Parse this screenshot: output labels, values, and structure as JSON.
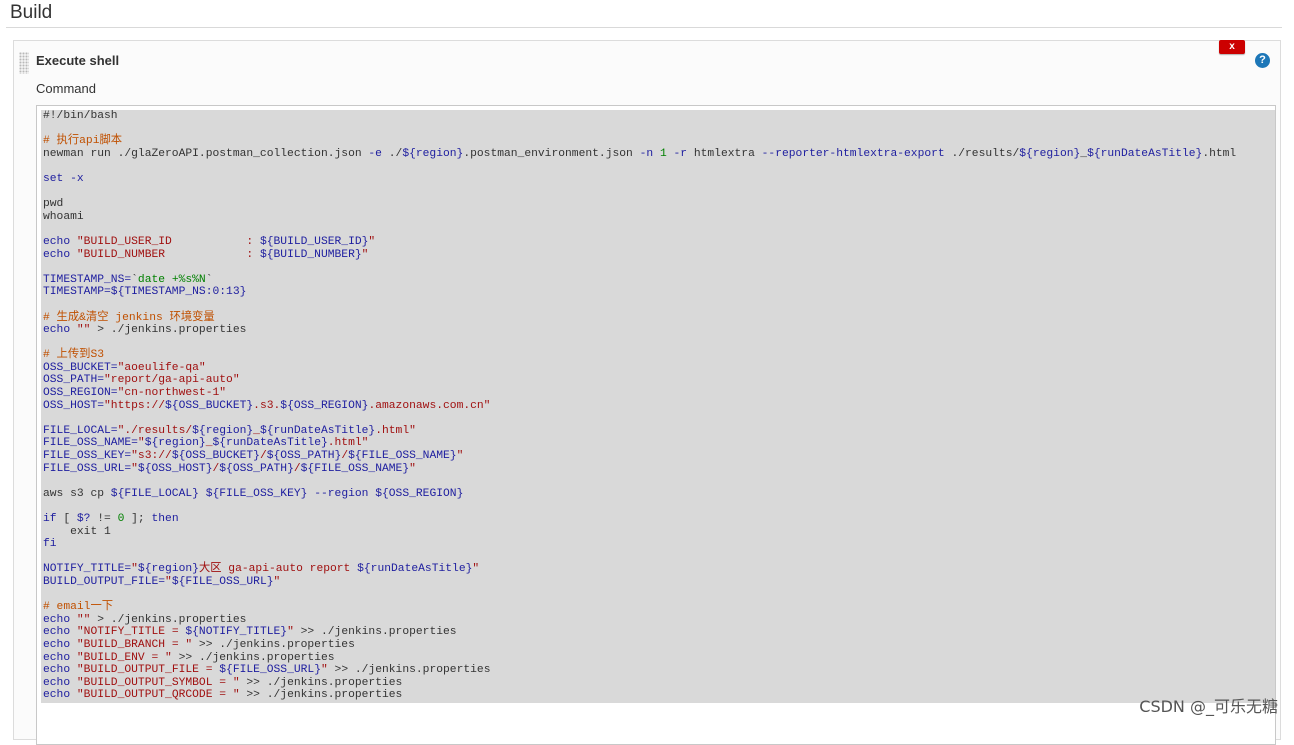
{
  "section": {
    "title": "Build"
  },
  "step": {
    "title": "Execute shell",
    "delete_label": "x",
    "help_label": "?",
    "command_label": "Command"
  },
  "colors": {
    "comment": "#c05000",
    "keyword": "#2020a0",
    "string": "#a01010",
    "variable": "#2020a0",
    "text": "#333333",
    "green": "#008000",
    "delete_button": "#cc0000",
    "help_icon": "#1d77b8",
    "code_highlight": "#d9d9d9"
  },
  "code_lines": [
    [
      {
        "t": "txt",
        "v": "#!/bin/bash"
      }
    ],
    [],
    [
      {
        "t": "cmt",
        "v": "# 执行api脚本"
      }
    ],
    [
      {
        "t": "txt",
        "v": "newman run ./glaZeroAPI.postman_collection.json "
      },
      {
        "t": "kw",
        "v": "-e"
      },
      {
        "t": "txt",
        "v": " ./"
      },
      {
        "t": "var",
        "v": "${region}"
      },
      {
        "t": "txt",
        "v": ".postman_environment.json "
      },
      {
        "t": "kw",
        "v": "-n"
      },
      {
        "t": "txt",
        "v": " "
      },
      {
        "t": "grn",
        "v": "1"
      },
      {
        "t": "txt",
        "v": " "
      },
      {
        "t": "kw",
        "v": "-r"
      },
      {
        "t": "txt",
        "v": " htmlextra "
      },
      {
        "t": "kw",
        "v": "--reporter-htmlextra-export"
      },
      {
        "t": "txt",
        "v": " ./results/"
      },
      {
        "t": "var",
        "v": "${region}"
      },
      {
        "t": "txt",
        "v": "_"
      },
      {
        "t": "var",
        "v": "${runDateAsTitle}"
      },
      {
        "t": "txt",
        "v": ".html"
      }
    ],
    [],
    [
      {
        "t": "kw",
        "v": "set -x"
      }
    ],
    [],
    [
      {
        "t": "txt",
        "v": "pwd"
      }
    ],
    [
      {
        "t": "txt",
        "v": "whoami"
      }
    ],
    [],
    [
      {
        "t": "kw",
        "v": "echo "
      },
      {
        "t": "str",
        "v": "\"BUILD_USER_ID           : "
      },
      {
        "t": "var",
        "v": "${BUILD_USER_ID}"
      },
      {
        "t": "str",
        "v": "\""
      }
    ],
    [
      {
        "t": "kw",
        "v": "echo "
      },
      {
        "t": "str",
        "v": "\"BUILD_NUMBER            : "
      },
      {
        "t": "var",
        "v": "${BUILD_NUMBER}"
      },
      {
        "t": "str",
        "v": "\""
      }
    ],
    [],
    [
      {
        "t": "var",
        "v": "TIMESTAMP_NS="
      },
      {
        "t": "txt",
        "v": "`"
      },
      {
        "t": "grn",
        "v": "date +%s%N"
      },
      {
        "t": "txt",
        "v": "`"
      }
    ],
    [
      {
        "t": "var",
        "v": "TIMESTAMP=${TIMESTAMP_NS:0:13}"
      }
    ],
    [],
    [
      {
        "t": "cmt",
        "v": "# 生成&清空 jenkins 环境变量"
      }
    ],
    [
      {
        "t": "kw",
        "v": "echo "
      },
      {
        "t": "str",
        "v": "\"\""
      },
      {
        "t": "txt",
        "v": " > ./jenkins.properties"
      }
    ],
    [],
    [
      {
        "t": "cmt",
        "v": "# 上传到S3"
      }
    ],
    [
      {
        "t": "var",
        "v": "OSS_BUCKET="
      },
      {
        "t": "str",
        "v": "\"aoeulife-qa\""
      }
    ],
    [
      {
        "t": "var",
        "v": "OSS_PATH="
      },
      {
        "t": "str",
        "v": "\"report/ga-api-auto\""
      }
    ],
    [
      {
        "t": "var",
        "v": "OSS_REGION="
      },
      {
        "t": "str",
        "v": "\"cn-northwest-1\""
      }
    ],
    [
      {
        "t": "var",
        "v": "OSS_HOST="
      },
      {
        "t": "str",
        "v": "\"https://"
      },
      {
        "t": "var",
        "v": "${OSS_BUCKET}"
      },
      {
        "t": "str",
        "v": ".s3."
      },
      {
        "t": "var",
        "v": "${OSS_REGION}"
      },
      {
        "t": "str",
        "v": ".amazonaws.com.cn\""
      }
    ],
    [],
    [
      {
        "t": "var",
        "v": "FILE_LOCAL="
      },
      {
        "t": "str",
        "v": "\"./results/"
      },
      {
        "t": "var",
        "v": "${region}"
      },
      {
        "t": "str",
        "v": "_"
      },
      {
        "t": "var",
        "v": "${runDateAsTitle}"
      },
      {
        "t": "str",
        "v": ".html\""
      }
    ],
    [
      {
        "t": "var",
        "v": "FILE_OSS_NAME="
      },
      {
        "t": "str",
        "v": "\""
      },
      {
        "t": "var",
        "v": "${region}"
      },
      {
        "t": "str",
        "v": "_"
      },
      {
        "t": "var",
        "v": "${runDateAsTitle}"
      },
      {
        "t": "str",
        "v": ".html\""
      }
    ],
    [
      {
        "t": "var",
        "v": "FILE_OSS_KEY="
      },
      {
        "t": "str",
        "v": "\"s3://"
      },
      {
        "t": "var",
        "v": "${OSS_BUCKET}"
      },
      {
        "t": "str",
        "v": "/"
      },
      {
        "t": "var",
        "v": "${OSS_PATH}"
      },
      {
        "t": "str",
        "v": "/"
      },
      {
        "t": "var",
        "v": "${FILE_OSS_NAME}"
      },
      {
        "t": "str",
        "v": "\""
      }
    ],
    [
      {
        "t": "var",
        "v": "FILE_OSS_URL="
      },
      {
        "t": "str",
        "v": "\""
      },
      {
        "t": "var",
        "v": "${OSS_HOST}"
      },
      {
        "t": "str",
        "v": "/"
      },
      {
        "t": "var",
        "v": "${OSS_PATH}"
      },
      {
        "t": "str",
        "v": "/"
      },
      {
        "t": "var",
        "v": "${FILE_OSS_NAME}"
      },
      {
        "t": "str",
        "v": "\""
      }
    ],
    [],
    [
      {
        "t": "txt",
        "v": "aws s3 cp "
      },
      {
        "t": "var",
        "v": "${FILE_LOCAL}"
      },
      {
        "t": "txt",
        "v": " "
      },
      {
        "t": "var",
        "v": "${FILE_OSS_KEY}"
      },
      {
        "t": "txt",
        "v": " "
      },
      {
        "t": "kw",
        "v": "--region"
      },
      {
        "t": "txt",
        "v": " "
      },
      {
        "t": "var",
        "v": "${OSS_REGION}"
      }
    ],
    [],
    [
      {
        "t": "kw",
        "v": "if"
      },
      {
        "t": "txt",
        "v": " [ "
      },
      {
        "t": "var",
        "v": "$?"
      },
      {
        "t": "txt",
        "v": " != "
      },
      {
        "t": "grn",
        "v": "0"
      },
      {
        "t": "txt",
        "v": " ]; "
      },
      {
        "t": "kw",
        "v": "then"
      }
    ],
    [
      {
        "t": "txt",
        "v": "    exit 1"
      }
    ],
    [
      {
        "t": "kw",
        "v": "fi"
      }
    ],
    [],
    [
      {
        "t": "var",
        "v": "NOTIFY_TITLE="
      },
      {
        "t": "str",
        "v": "\""
      },
      {
        "t": "var",
        "v": "${region}"
      },
      {
        "t": "str",
        "v": "大区 ga-api-auto report "
      },
      {
        "t": "var",
        "v": "${runDateAsTitle}"
      },
      {
        "t": "str",
        "v": "\""
      }
    ],
    [
      {
        "t": "var",
        "v": "BUILD_OUTPUT_FILE="
      },
      {
        "t": "str",
        "v": "\""
      },
      {
        "t": "var",
        "v": "${FILE_OSS_URL}"
      },
      {
        "t": "str",
        "v": "\""
      }
    ],
    [],
    [
      {
        "t": "cmt",
        "v": "# email一下"
      }
    ],
    [
      {
        "t": "kw",
        "v": "echo "
      },
      {
        "t": "str",
        "v": "\"\""
      },
      {
        "t": "txt",
        "v": " > ./jenkins.properties"
      }
    ],
    [
      {
        "t": "kw",
        "v": "echo "
      },
      {
        "t": "str",
        "v": "\"NOTIFY_TITLE = "
      },
      {
        "t": "var",
        "v": "${NOTIFY_TITLE}"
      },
      {
        "t": "str",
        "v": "\""
      },
      {
        "t": "txt",
        "v": " >> ./jenkins.properties"
      }
    ],
    [
      {
        "t": "kw",
        "v": "echo "
      },
      {
        "t": "str",
        "v": "\"BUILD_BRANCH = \""
      },
      {
        "t": "txt",
        "v": " >> ./jenkins.properties"
      }
    ],
    [
      {
        "t": "kw",
        "v": "echo "
      },
      {
        "t": "str",
        "v": "\"BUILD_ENV = \""
      },
      {
        "t": "txt",
        "v": " >> ./jenkins.properties"
      }
    ],
    [
      {
        "t": "kw",
        "v": "echo "
      },
      {
        "t": "str",
        "v": "\"BUILD_OUTPUT_FILE = "
      },
      {
        "t": "var",
        "v": "${FILE_OSS_URL}"
      },
      {
        "t": "str",
        "v": "\""
      },
      {
        "t": "txt",
        "v": " >> ./jenkins.properties"
      }
    ],
    [
      {
        "t": "kw",
        "v": "echo "
      },
      {
        "t": "str",
        "v": "\"BUILD_OUTPUT_SYMBOL = \""
      },
      {
        "t": "txt",
        "v": " >> ./jenkins.properties"
      }
    ],
    [
      {
        "t": "kw",
        "v": "echo "
      },
      {
        "t": "str",
        "v": "\"BUILD_OUTPUT_QRCODE = \""
      },
      {
        "t": "txt",
        "v": " >> ./jenkins.properties"
      }
    ]
  ],
  "watermark": "CSDN @_可乐无糖"
}
